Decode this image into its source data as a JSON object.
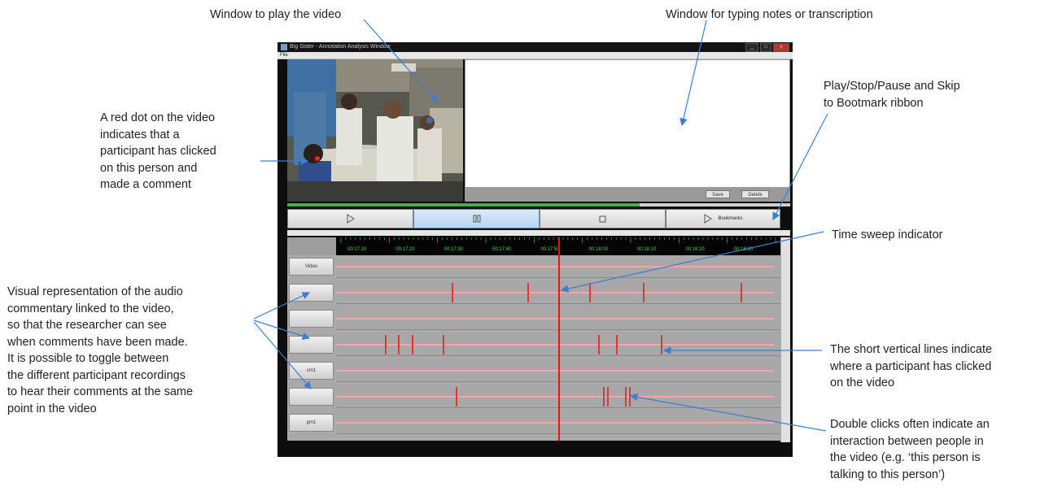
{
  "callouts": {
    "video_window": "Window to play the video",
    "notes_window": "Window for typing notes or transcription",
    "ribbon": "Play/Stop/Pause and Skip\nto Bootmark ribbon",
    "red_dot": "A red dot on the video\nindicates that a\nparticipant has clicked\non this person and\nmade a comment",
    "time_sweep": "Time sweep indicator",
    "audio_rep": "Visual representation of the audio\ncommentary linked to the video,\nso that the researcher can see\nwhen comments have been made.\nIt is possible to toggle between\nthe different participant recordings\nto hear their comments at the same\npoint in the video",
    "short_lines": "The short vertical lines indicate\nwhere a participant has clicked\non the video",
    "double_clicks": "Double clicks often indicate an\ninteraction between people in\nthe video (e.g. ‘this person is\ntalking to this person’)"
  },
  "window": {
    "title": "Big Sister - Annotation Analysis Window",
    "menu_file": "File",
    "btn_min": "_",
    "btn_max": "□",
    "btn_close": "x"
  },
  "notes": {
    "save_label": "Save",
    "delete_label": "Delete"
  },
  "playback_progress_pct": 70,
  "ribbon": {
    "play_icon": "play-icon",
    "pause_icon": "pause-icon",
    "stop_icon": "stop-icon",
    "bookmark_label": "Bookmarks"
  },
  "timeline": {
    "ticks": [
      "00:17:10",
      "00:17:20",
      "00:17:30",
      "00:17:40",
      "00:17:50",
      "00:18:00",
      "00:18:10",
      "00:18:20",
      "00:18:30"
    ],
    "tracks": [
      {
        "label": "Video",
        "marks": []
      },
      {
        "label": "",
        "marks": [
          0.26,
          0.43,
          0.57,
          0.69,
          0.91
        ]
      },
      {
        "label": "",
        "marks": []
      },
      {
        "label": "",
        "marks": [
          0.11,
          0.14,
          0.17,
          0.24,
          0.5,
          0.59,
          0.63,
          0.73
        ]
      },
      {
        "label": "cm1",
        "marks": []
      },
      {
        "label": "",
        "marks": [
          0.27,
          0.6,
          0.61,
          0.65,
          0.66
        ]
      },
      {
        "label": "pm1",
        "marks": []
      }
    ],
    "sweep_position": 0.5
  },
  "colors": {
    "marker": "#d83a3a",
    "sweep": "#e01818",
    "arrow": "#3d7fcc",
    "ruler_text": "#3ddc4a"
  }
}
